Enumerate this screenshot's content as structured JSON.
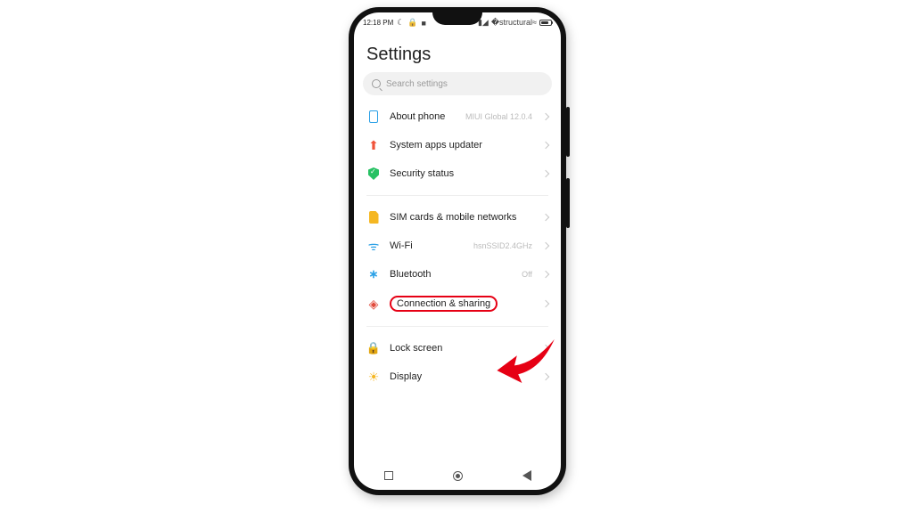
{
  "statusbar": {
    "time": "12:18 PM"
  },
  "header": {
    "title": "Settings"
  },
  "search": {
    "placeholder": "Search settings"
  },
  "items": [
    {
      "label": "About phone",
      "trail": "MIUI Global 12.0.4"
    },
    {
      "label": "System apps updater",
      "trail": ""
    },
    {
      "label": "Security status",
      "trail": ""
    },
    {
      "label": "SIM cards & mobile networks",
      "trail": ""
    },
    {
      "label": "Wi-Fi",
      "trail": "hsnSSID2.4GHz"
    },
    {
      "label": "Bluetooth",
      "trail": "Off"
    },
    {
      "label": "Connection & sharing",
      "trail": ""
    },
    {
      "label": "Lock screen",
      "trail": ""
    },
    {
      "label": "Display",
      "trail": ""
    }
  ],
  "highlighted_item_index": 6
}
